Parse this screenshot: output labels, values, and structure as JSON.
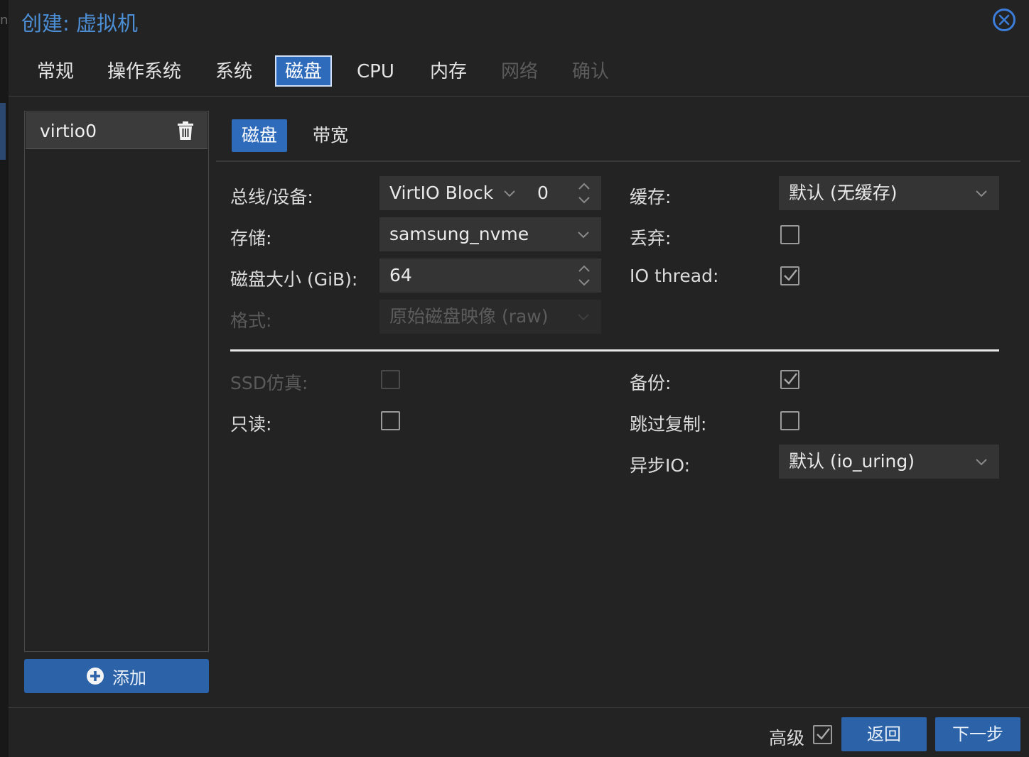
{
  "edge": {
    "fragment": "ne"
  },
  "dialog": {
    "title": "创建: 虚拟机"
  },
  "tabs": [
    {
      "label": "常规",
      "state": "normal"
    },
    {
      "label": "操作系统",
      "state": "normal"
    },
    {
      "label": "系统",
      "state": "normal"
    },
    {
      "label": "磁盘",
      "state": "active"
    },
    {
      "label": "CPU",
      "state": "normal"
    },
    {
      "label": "内存",
      "state": "normal"
    },
    {
      "label": "网络",
      "state": "disabled"
    },
    {
      "label": "确认",
      "state": "disabled"
    }
  ],
  "disk_list": {
    "items": [
      {
        "label": "virtio0",
        "icon": "trash-icon"
      }
    ],
    "add_label": "添加"
  },
  "subtabs": [
    {
      "label": "磁盘",
      "state": "active"
    },
    {
      "label": "带宽",
      "state": "normal"
    }
  ],
  "form": {
    "bus_device": {
      "label": "总线/设备:",
      "bus": "VirtIO Block",
      "device": "0"
    },
    "storage": {
      "label": "存储:",
      "value": "samsung_nvme"
    },
    "disk_size": {
      "label": "磁盘大小 (GiB):",
      "value": "64"
    },
    "format": {
      "label": "格式:",
      "value": "原始磁盘映像 (raw)",
      "disabled": true
    },
    "cache": {
      "label": "缓存:",
      "value": "默认 (无缓存)"
    },
    "discard": {
      "label": "丢弃:",
      "checked": false
    },
    "io_thread": {
      "label": "IO thread:",
      "checked": true
    },
    "ssd_emulation": {
      "label": "SSD仿真:",
      "checked": false,
      "disabled": true
    },
    "readonly": {
      "label": "只读:",
      "checked": false
    },
    "backup": {
      "label": "备份:",
      "checked": true
    },
    "skip_replication": {
      "label": "跳过复制:",
      "checked": false
    },
    "async_io": {
      "label": "异步IO:",
      "value": "默认 (io_uring)"
    }
  },
  "footer": {
    "advanced_label": "高级",
    "advanced_checked": true,
    "back_label": "返回",
    "next_label": "下一步"
  },
  "colors": {
    "accent": "#2f6bbb",
    "button": "#2c62a8",
    "title": "#4c8fd6",
    "background": "#232323"
  }
}
